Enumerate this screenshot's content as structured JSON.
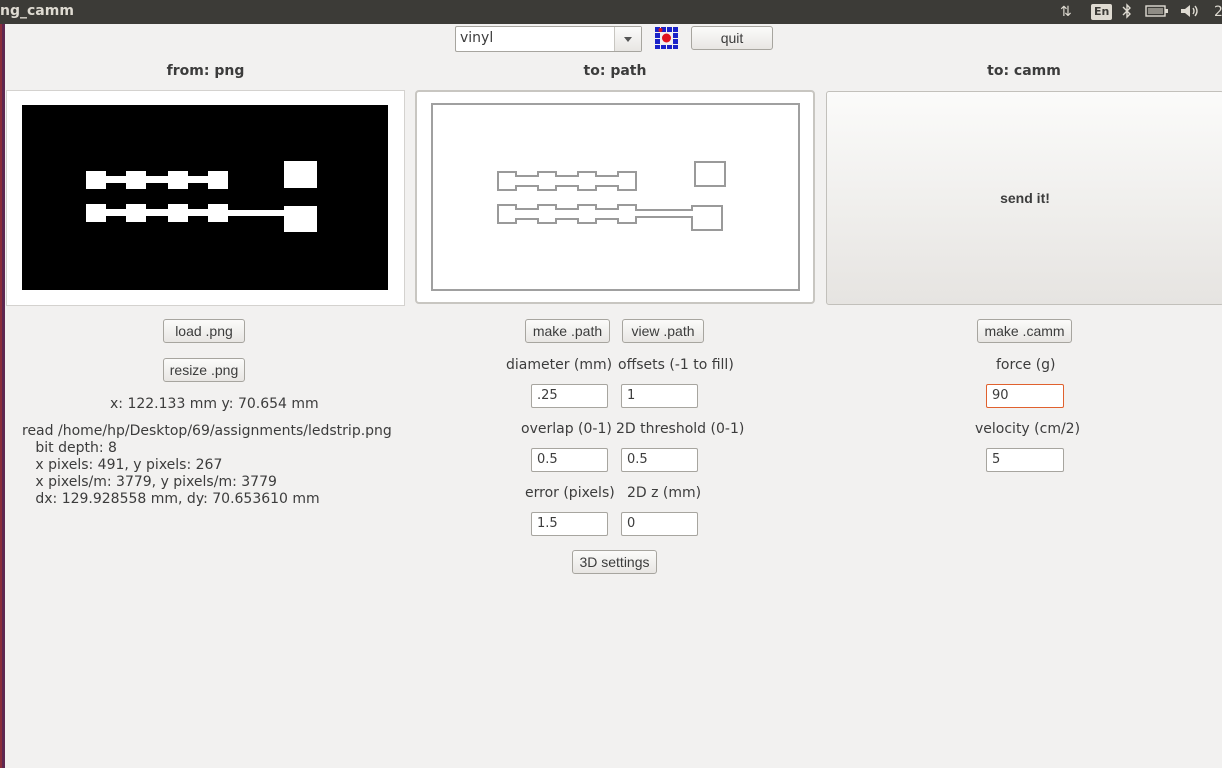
{
  "window": {
    "title": "ng_camm"
  },
  "indicators": {
    "keyboard": "En",
    "clock_partial": "2"
  },
  "toolbar": {
    "machine_value": "vinyl",
    "quit_label": "quit"
  },
  "columns": {
    "png_header": "from: png",
    "path_header": "to: path",
    "camm_header": "to: camm"
  },
  "png": {
    "load_label": "load .png",
    "resize_label": "resize .png",
    "size_readout": "x: 122.133 mm  y: 70.654 mm",
    "info_line1": "read /home/hp/Desktop/69/assignments/ledstrip.png",
    "info_line2": "   bit depth: 8",
    "info_line3": "   x pixels: 491, y pixels: 267",
    "info_line4": "   x pixels/m: 3779, y pixels/m: 3779",
    "info_line5": "   dx: 129.928558 mm, dy: 70.653610 mm"
  },
  "path": {
    "make_label": "make .path",
    "view_label": "view .path",
    "diameter_label": "diameter (mm)",
    "diameter_value": ".25",
    "offsets_label": "offsets (-1 to fill)",
    "offsets_value": "1",
    "overlap_label": "overlap (0-1)",
    "overlap_value": "0.5",
    "threshold_label": "2D threshold (0-1)",
    "threshold_value": "0.5",
    "error_label": "error (pixels)",
    "error_value": "1.5",
    "z_label": "2D z (mm)",
    "z_value": "0",
    "settings3d_label": "3D settings"
  },
  "camm": {
    "send_label": "send it!",
    "make_label": "make .camm",
    "force_label": "force (g)",
    "force_value": "90",
    "velocity_label": "velocity (cm/2)",
    "velocity_value": "5"
  },
  "colors": {
    "accent_focus": "#e0612e",
    "panel_bar": "#3c3b37"
  }
}
